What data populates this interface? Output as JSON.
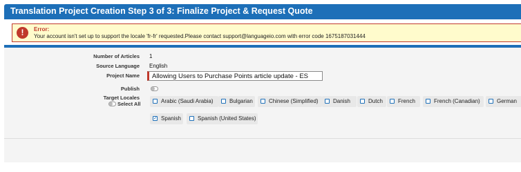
{
  "header": {
    "title": "Translation Project Creation Step 3 of 3: Finalize Project & Request Quote"
  },
  "error": {
    "title": "Error:",
    "message": "Your account isn't set up to support the locale 'fr-fr' requested.Please contact support@languageio.com with error code 1675187031444",
    "icon": "exclamation-icon",
    "color": "#c0392b"
  },
  "form": {
    "articles_label": "Number of Articles",
    "articles_value": "1",
    "source_label": "Source Language",
    "source_value": "English",
    "project_name_label": "Project Name",
    "project_name_value": "Allowing Users to Purchase Points article update - ES",
    "publish_label": "Publish",
    "publish_on": false,
    "target_locales_label": "Target Locales",
    "select_all_label": "Select All",
    "locales": [
      {
        "label": "Arabic (Saudi Arabia)",
        "checked": false
      },
      {
        "label": "Bulgarian",
        "checked": false
      },
      {
        "label": "Chinese (Simplified)",
        "checked": false
      },
      {
        "label": "Danish",
        "checked": false
      },
      {
        "label": "Dutch",
        "checked": false
      },
      {
        "label": "French",
        "checked": false
      },
      {
        "label": "French (Canadian)",
        "checked": false
      },
      {
        "label": "German",
        "checked": false
      },
      {
        "label": "Spanish",
        "checked": true
      },
      {
        "label": "Spanish (United States)",
        "checked": false
      }
    ]
  },
  "colors": {
    "accent": "#1d6fb8",
    "error": "#c0392b",
    "panel": "#f4f4f4"
  }
}
